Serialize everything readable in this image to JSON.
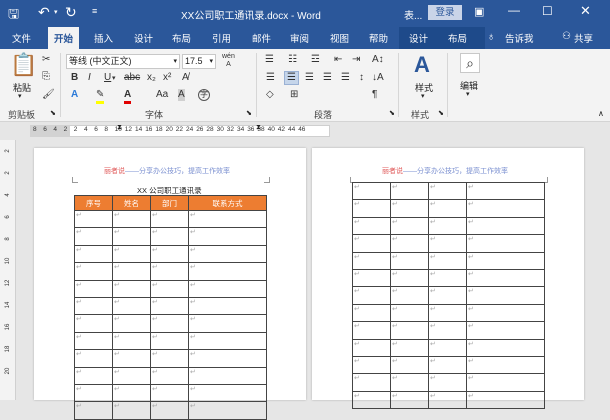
{
  "titlebar": {
    "doc_title": "XX公司职工通讯录.docx  -  Word",
    "table_tools": "表...",
    "login": "登录"
  },
  "tabs": [
    "文件",
    "开始",
    "插入",
    "设计",
    "布局",
    "引用",
    "邮件",
    "审阅",
    "视图",
    "帮助",
    "设计",
    "布局"
  ],
  "active_tab": "开始",
  "tell_me": "告诉我",
  "share": "共享",
  "clipboard": {
    "paste": "粘贴",
    "label": "剪贴板"
  },
  "font": {
    "name": "等线 (中文正文)",
    "size": "17.5",
    "label": "字体"
  },
  "paragraph": {
    "label": "段落"
  },
  "styles": {
    "button": "样式",
    "label": "样式"
  },
  "editing": {
    "button": "编辑"
  },
  "ruler": {
    "ticks": [
      "8",
      "6",
      "4",
      "2",
      "2",
      "4",
      "6",
      "8",
      "10",
      "12",
      "14",
      "16",
      "18",
      "20",
      "22",
      "24",
      "26",
      "28",
      "30",
      "32",
      "34",
      "36",
      "38",
      "40",
      "42",
      "44",
      "46"
    ]
  },
  "vruler": {
    "ticks": [
      "2",
      "2",
      "4",
      "6",
      "8",
      "10",
      "12",
      "14",
      "16",
      "18",
      "20"
    ]
  },
  "page1": {
    "header_left": "丽者说",
    "header_right": "——分享办公技巧，提高工作效率",
    "table_title": "XX 公司职工通讯录",
    "columns": [
      "序号",
      "姓名",
      "部门",
      "联系方式"
    ],
    "cell_mark": "↵"
  },
  "page2": {
    "header_left": "丽者说",
    "header_right": "——分享办公技巧，提高工作效率"
  },
  "colors": {
    "word_blue": "#2b579a",
    "table_header": "#ed7d31",
    "header_red": "#e05a5a",
    "header_blue": "#7a8fd0"
  }
}
